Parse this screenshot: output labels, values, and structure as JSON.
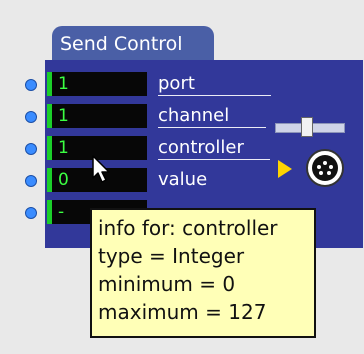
{
  "module": {
    "title": "Send Control"
  },
  "fields": [
    {
      "value": "1",
      "label": "port"
    },
    {
      "value": "1",
      "label": "channel"
    },
    {
      "value": "1",
      "label": "controller"
    },
    {
      "value": "0",
      "label": "value"
    },
    {
      "value": "-",
      "label": ""
    }
  ],
  "tooltip": {
    "line1": "info for: controller",
    "line2": "type = Integer",
    "line3": "minimum = 0",
    "line4": "maximum = 127"
  },
  "colors": {
    "panel": "#32389a",
    "tab": "#4a5fa6",
    "field_text": "#3bff42",
    "tooltip_bg": "#ffffb7"
  }
}
